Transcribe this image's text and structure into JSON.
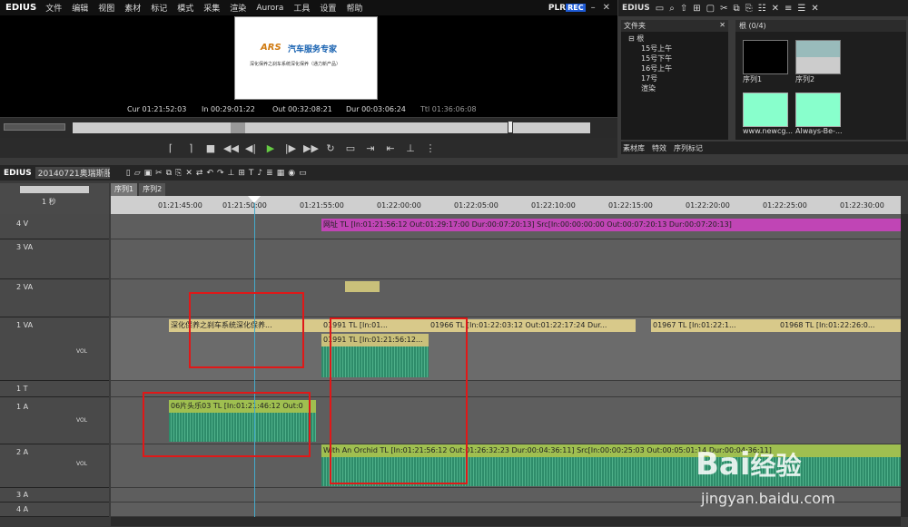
{
  "app": {
    "name": "EDIUS"
  },
  "menu": [
    "文件",
    "编辑",
    "视图",
    "素材",
    "标记",
    "模式",
    "采集",
    "渲染",
    "Aurora",
    "工具",
    "设置",
    "帮助"
  ],
  "player": {
    "plr": "PLR",
    "rec": "REC",
    "card": {
      "brand": "ARS",
      "title": "汽车服务专家",
      "subtitle": "深化保养之刹车系统深化保养（通力新产品）"
    },
    "cur": "Cur 01:21:52:03",
    "in": "In 00:29:01:22",
    "out": "Out 00:32:08:21",
    "dur": "Dur 00:03:06:24",
    "ttl": "Ttl 01:36:06:08"
  },
  "bin": {
    "logo": "EDIUS",
    "tree_header": "文件夹",
    "tree_root": "根",
    "folders": [
      "15号上午",
      "15号下午",
      "16号上午",
      "17号",
      "渲染"
    ],
    "root_label": "根 (0/4)",
    "clips": [
      "序列1",
      "序列2",
      "www.newcg...",
      "Always-Be-..."
    ],
    "tabs": [
      "素材库",
      "特效",
      "序列标记"
    ]
  },
  "timeline": {
    "project": "20140721奥瑞斯服...",
    "seq_tabs": [
      "序列1",
      "序列2"
    ],
    "zoom": "1 秒",
    "ruler": [
      "01:21:45:00",
      "01:21:50:00",
      "01:21:55:00",
      "01:22:00:00",
      "01:22:05:00",
      "01:22:10:00",
      "01:22:15:00",
      "01:22:20:00",
      "01:22:25:00",
      "01:22:30:00"
    ],
    "tracks": [
      "4 V",
      "3 VA",
      "2 VA",
      "1 VA",
      "1 T",
      "1 A",
      "2 A",
      "3 A",
      "4 A"
    ],
    "vol": "VOL",
    "clips": {
      "v4": "网址  TL [In:01:21:56:12 Out:01:29:17:00 Dur:00:07:20:13]  Src[In:00:00:00:00 Out:00:07:20:13 Dur:00:07:20:13]",
      "v1a": "深化保养之刹车系统深化保养...",
      "v1b": "01991  TL [In:01...",
      "v1c": "01966  TL [In:01:22:03:12 Out:01:22:17:24 Dur...",
      "v1d": "01967  TL [In:01:22:1...",
      "v1e": "01968  TL [In:01:22:26:0...",
      "v1aud": "01991  TL [In:01:21:56:12...",
      "a1": "06片头乐03  TL [In:01:21:46:12 Out:0",
      "a2": "With An Orchid  TL [In:01:21:56:12 Out:01:26:32:23 Dur:00:04:36:11]  Src[In:00:00:25:03 Out:00:05:01:14 Dur:00:04:36:11]"
    }
  },
  "watermark": {
    "brand": "Bai",
    "brand2": "经验",
    "url": "jingyan.baidu.com"
  }
}
